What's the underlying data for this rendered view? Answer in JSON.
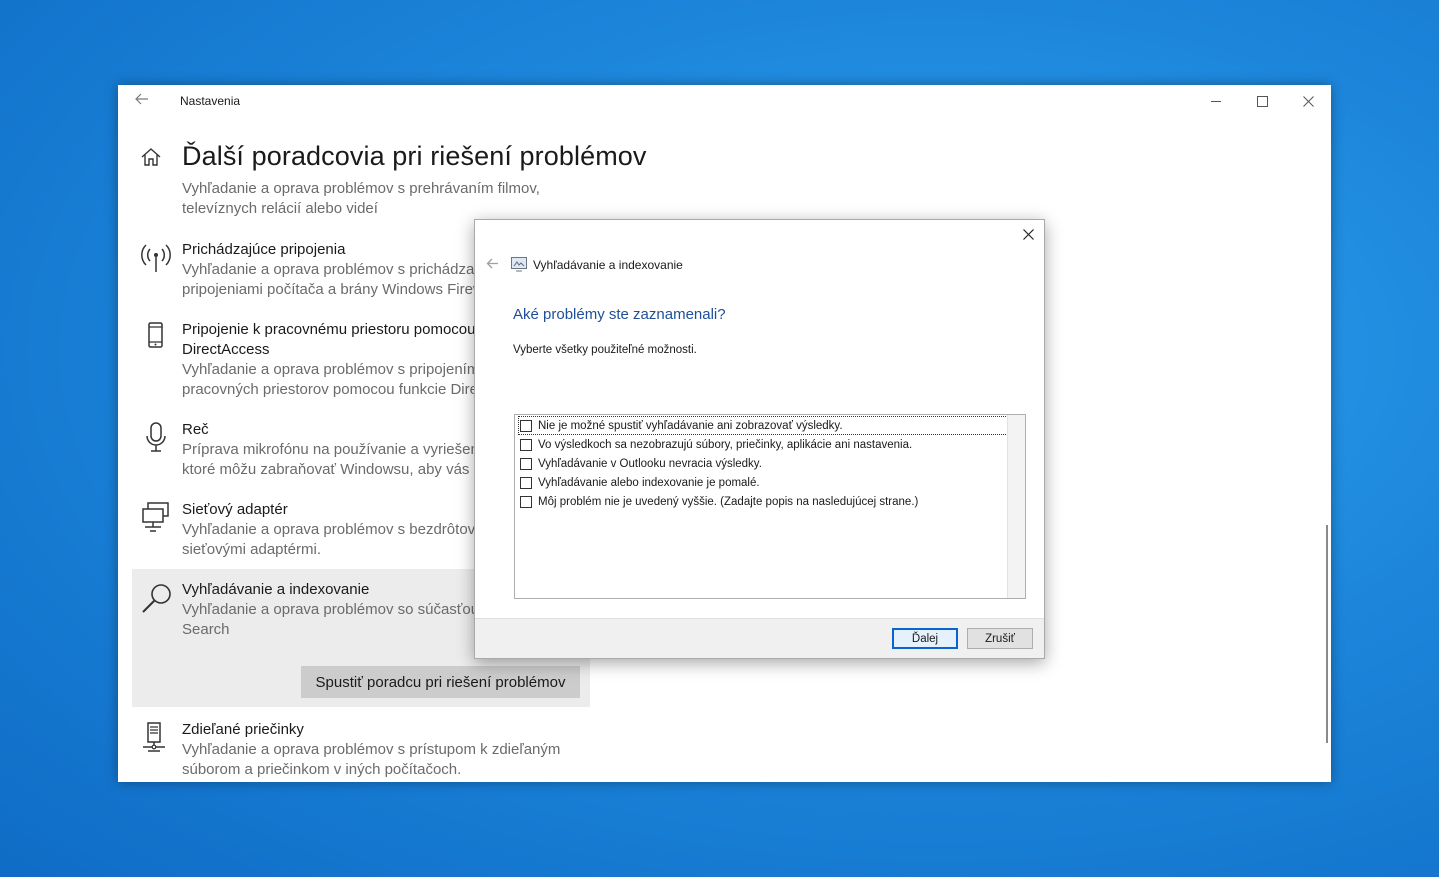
{
  "settings": {
    "app_title": "Nastavenia",
    "page_title": "Ďalší poradcovia pri riešení problémov",
    "page_desc_lines": [
      "Vyhľadanie a oprava problémov s prehrávaním filmov,",
      "televíznych relácií alebo videí"
    ],
    "items": [
      {
        "title": "Prichádzajúce pripojenia",
        "desc": [
          "Vyhľadanie a oprava problémov s prichádzaj",
          "pripojeniami počítača a brány Windows Firew"
        ],
        "icon": "antenna-icon"
      },
      {
        "title": "Pripojenie k pracovnému priestoru pomocou",
        "title2": "DirectAccess",
        "desc": [
          "Vyhľadanie a oprava problémov s pripojením",
          "pracovných priestorov pomocou funkcie Dire"
        ],
        "icon": "phone-icon"
      },
      {
        "title": "Reč",
        "desc": [
          "Príprava mikrofónu na používanie a vyriešen",
          "ktoré môžu zabraňovať Windowsu, aby vás p"
        ],
        "icon": "microphone-icon"
      },
      {
        "title": "Sieťový adaptér",
        "desc": [
          "Vyhľadanie a oprava problémov s bezdrôtov",
          "sieťovými adaptérmi."
        ],
        "icon": "network-adapter-icon"
      },
      {
        "title": "Vyhľadávanie a indexovanie",
        "desc": [
          "Vyhľadanie a oprava problémov so súčasťou",
          "Search"
        ],
        "icon": "search-icon"
      },
      {
        "title": "Zdieľané priečinky",
        "desc": [
          "Vyhľadanie a oprava problémov s prístupom k zdieľaným",
          "súborom a priečinkom v iných počítačoch."
        ],
        "icon": "shared-folder-icon"
      }
    ],
    "run_button_label": "Spustiť poradcu pri riešení problémov"
  },
  "dialog": {
    "app_name": "Vyhľadávanie a indexovanie",
    "heading": "Aké problémy ste zaznamenali?",
    "instruction": "Vyberte všetky použiteľné možnosti.",
    "options": [
      "Nie je možné spustiť vyhľadávanie ani zobrazovať výsledky.",
      "Vo výsledkoch sa nezobrazujú súbory, priečinky, aplikácie ani nastavenia.",
      "Vyhľadávanie v Outlooku nevracia výsledky.",
      "Vyhľadávanie alebo indexovanie je pomalé.",
      "Môj problém nie je uvedený vyššie. (Zadajte popis na nasledujúcej strane.)"
    ],
    "next_label": "Ďalej",
    "cancel_label": "Zrušiť"
  },
  "colors": {
    "accent": "#0a64cf",
    "heading_blue": "#1f4e9a",
    "desktop_blue": "#1d87dc"
  }
}
